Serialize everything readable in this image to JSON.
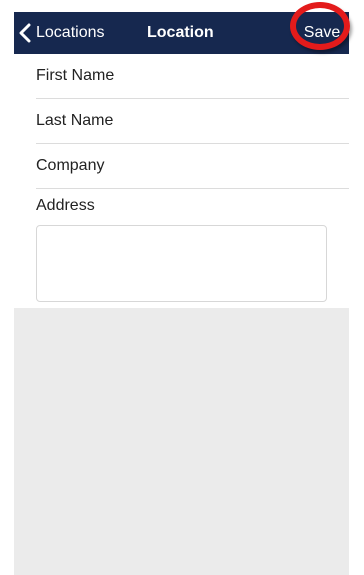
{
  "navbar": {
    "back_label": "Locations",
    "back_icon": "chevron-left-icon",
    "title": "Location",
    "save_label": "Save",
    "background_color": "#16284f"
  },
  "annotation": {
    "highlight_color": "#e31b1b",
    "highlighted_element": "save-button"
  },
  "form": {
    "fields": [
      {
        "label": "First Name",
        "value": ""
      },
      {
        "label": "Last Name",
        "value": ""
      },
      {
        "label": "Company",
        "value": ""
      }
    ],
    "address": {
      "label": "Address",
      "value": ""
    }
  }
}
